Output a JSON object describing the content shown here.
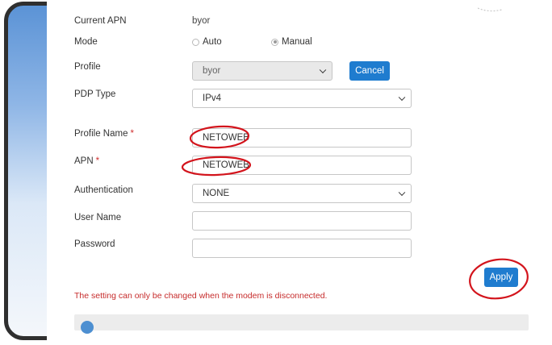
{
  "form": {
    "current_apn": {
      "label": "Current APN",
      "value": "byor"
    },
    "mode": {
      "label": "Mode",
      "options": [
        "Auto",
        "Manual"
      ],
      "selected": "Manual"
    },
    "profile": {
      "label": "Profile",
      "value": "byor",
      "cancel_label": "Cancel"
    },
    "pdp_type": {
      "label": "PDP Type",
      "value": "IPv4"
    },
    "profile_name": {
      "label": "Profile Name",
      "required_mark": "*",
      "value": "NETOWEB"
    },
    "apn": {
      "label": "APN",
      "required_mark": "*",
      "value": "NETOWEB"
    },
    "authentication": {
      "label": "Authentication",
      "value": "NONE"
    },
    "user_name": {
      "label": "User Name",
      "value": ""
    },
    "password": {
      "label": "Password",
      "value": ""
    },
    "apply_label": "Apply",
    "notice": "The setting can only be changed when the modem is disconnected."
  },
  "colors": {
    "accent": "#1f7ccf",
    "notice": "#c62b2b",
    "annotation": "#d3141c",
    "frame": "#2f2f2f"
  },
  "icons": {
    "dropdown": "chevron-down-icon",
    "info": "info-icon"
  }
}
